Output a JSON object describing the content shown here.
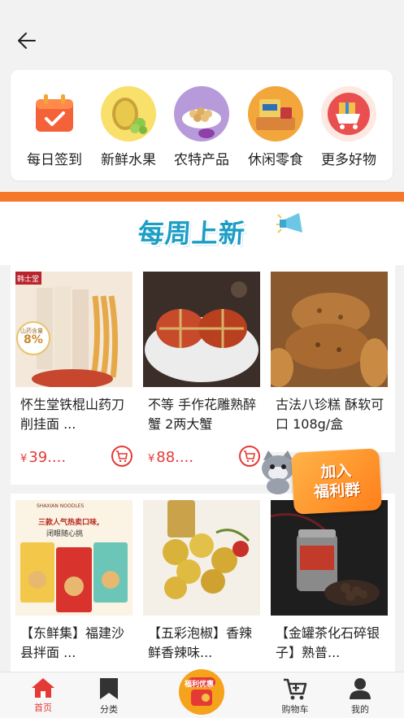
{
  "header": {
    "back_icon": "arrow-left-icon"
  },
  "categories": [
    {
      "label": "每日签到",
      "icon": "calendar-check-icon"
    },
    {
      "label": "新鲜水果",
      "icon": "fruit-icon"
    },
    {
      "label": "农特产品",
      "icon": "nuts-icon"
    },
    {
      "label": "休闲零食",
      "icon": "snacks-icon"
    },
    {
      "label": "更多好物",
      "icon": "gift-cart-icon"
    }
  ],
  "banner": {
    "title": "每周上新"
  },
  "products": [
    {
      "title": "怀生堂铁棍山药刀削挂面 ...",
      "price": "39....",
      "currency": "¥",
      "image_text_brand": "韩士堂",
      "image_text_pct": "8%",
      "image_text_sub": "山药含量"
    },
    {
      "title": "不等 手作花雕熟醉蟹 2两大蟹",
      "price": "88....",
      "currency": "¥"
    },
    {
      "title": "古法八珍糕 酥软可口 108g/盒",
      "price": "",
      "currency": ""
    },
    {
      "title": "【东鲜集】福建沙县拌面 ...",
      "price": "",
      "currency": "",
      "image_text_top": "SHAXIAN NOODLES",
      "image_text_line1": "三款人气热卖口味,",
      "image_text_line2": "闭眼随心挑"
    },
    {
      "title": "【五彩泡椒】香辣鲜香辣味...",
      "price": "",
      "currency": ""
    },
    {
      "title": "【金罐茶化石碎银子】熟普...",
      "price": "",
      "currency": ""
    }
  ],
  "floating_badge": {
    "line1": "加入",
    "line2": "福利群"
  },
  "tabbar": {
    "items": [
      {
        "label": "首页",
        "icon": "home-icon",
        "active": true
      },
      {
        "label": "分类",
        "icon": "bookmark-icon",
        "active": false
      },
      {
        "label": "",
        "icon": "welfare-gift-icon",
        "active": false,
        "promo_text": "福利优惠"
      },
      {
        "label": "购物车",
        "icon": "cart-icon",
        "active": false
      },
      {
        "label": "我的",
        "icon": "user-icon",
        "active": false
      }
    ]
  },
  "colors": {
    "accent": "#e53935",
    "orange_band": "#f5782a",
    "banner_blue": "#1c9ec4"
  }
}
